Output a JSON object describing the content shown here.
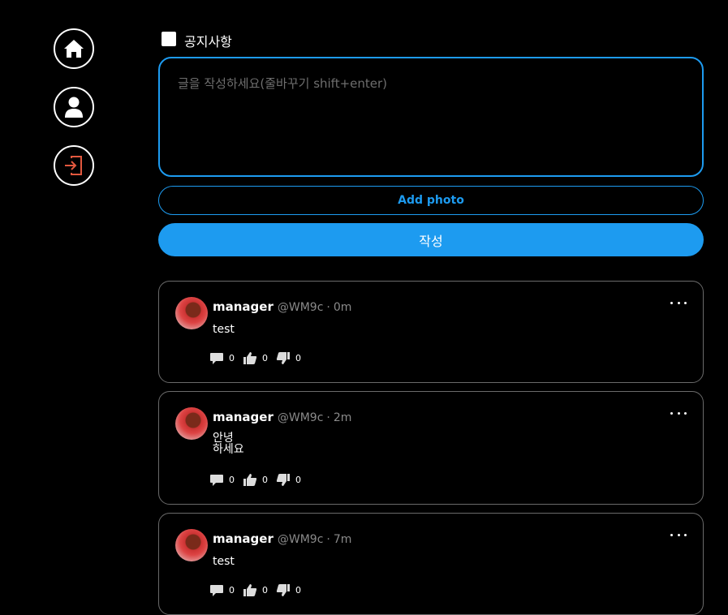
{
  "sidebar": {
    "items": [
      {
        "name": "home-icon"
      },
      {
        "name": "profile-icon"
      },
      {
        "name": "logout-icon",
        "color": "#e2583e"
      }
    ]
  },
  "composer": {
    "notice_label": "공지사항",
    "notice_checked": false,
    "placeholder": "글을 작성하세요(줄바꾸기 shift+enter)",
    "value": "",
    "add_photo_label": "Add photo",
    "submit_label": "작성"
  },
  "colors": {
    "accent": "#1d9bf0",
    "background": "#000000",
    "border": "#6a6a6a",
    "muted": "#8a8a8a"
  },
  "posts": [
    {
      "author": "manager",
      "handle": "@WM9c",
      "time": "0m",
      "body": [
        "test"
      ],
      "comments": "0",
      "likes": "0",
      "dislikes": "0"
    },
    {
      "author": "manager",
      "handle": "@WM9c",
      "time": "2m",
      "body": [
        "안녕",
        "하세요"
      ],
      "comments": "0",
      "likes": "0",
      "dislikes": "0"
    },
    {
      "author": "manager",
      "handle": "@WM9c",
      "time": "7m",
      "body": [
        "test"
      ],
      "comments": "0",
      "likes": "0",
      "dislikes": "0"
    }
  ]
}
